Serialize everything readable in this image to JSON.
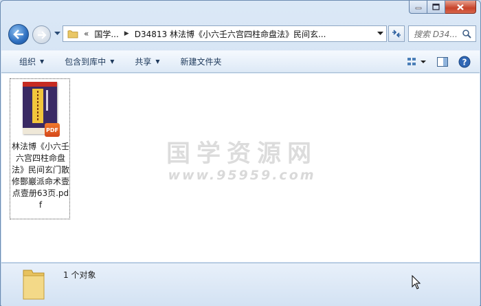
{
  "window": {
    "controls": {
      "minimize": "minimize",
      "maximize": "maximize",
      "close": "close"
    }
  },
  "address": {
    "overflow": "«",
    "crumbs": [
      "国学...",
      "D34813 林法博《小六壬六宫四柱命盘法》民间玄..."
    ]
  },
  "search": {
    "placeholder": "搜索 D34..."
  },
  "toolbar": {
    "organize": "组织",
    "include_in_library": "包含到库中",
    "share": "共享",
    "new_folder": "新建文件夹"
  },
  "file": {
    "name": "林法博《小六壬六宫四柱命盘法》民间玄门散修酆巖派命术壹点壹册63页.pdf",
    "badge": "PDF"
  },
  "watermark": {
    "title": "国学资源网",
    "url": "www.95959.com"
  },
  "status": {
    "count_text": "1 个对象"
  },
  "colors": {
    "accent": "#1e395b",
    "pdf_badge": "#e9641e"
  }
}
